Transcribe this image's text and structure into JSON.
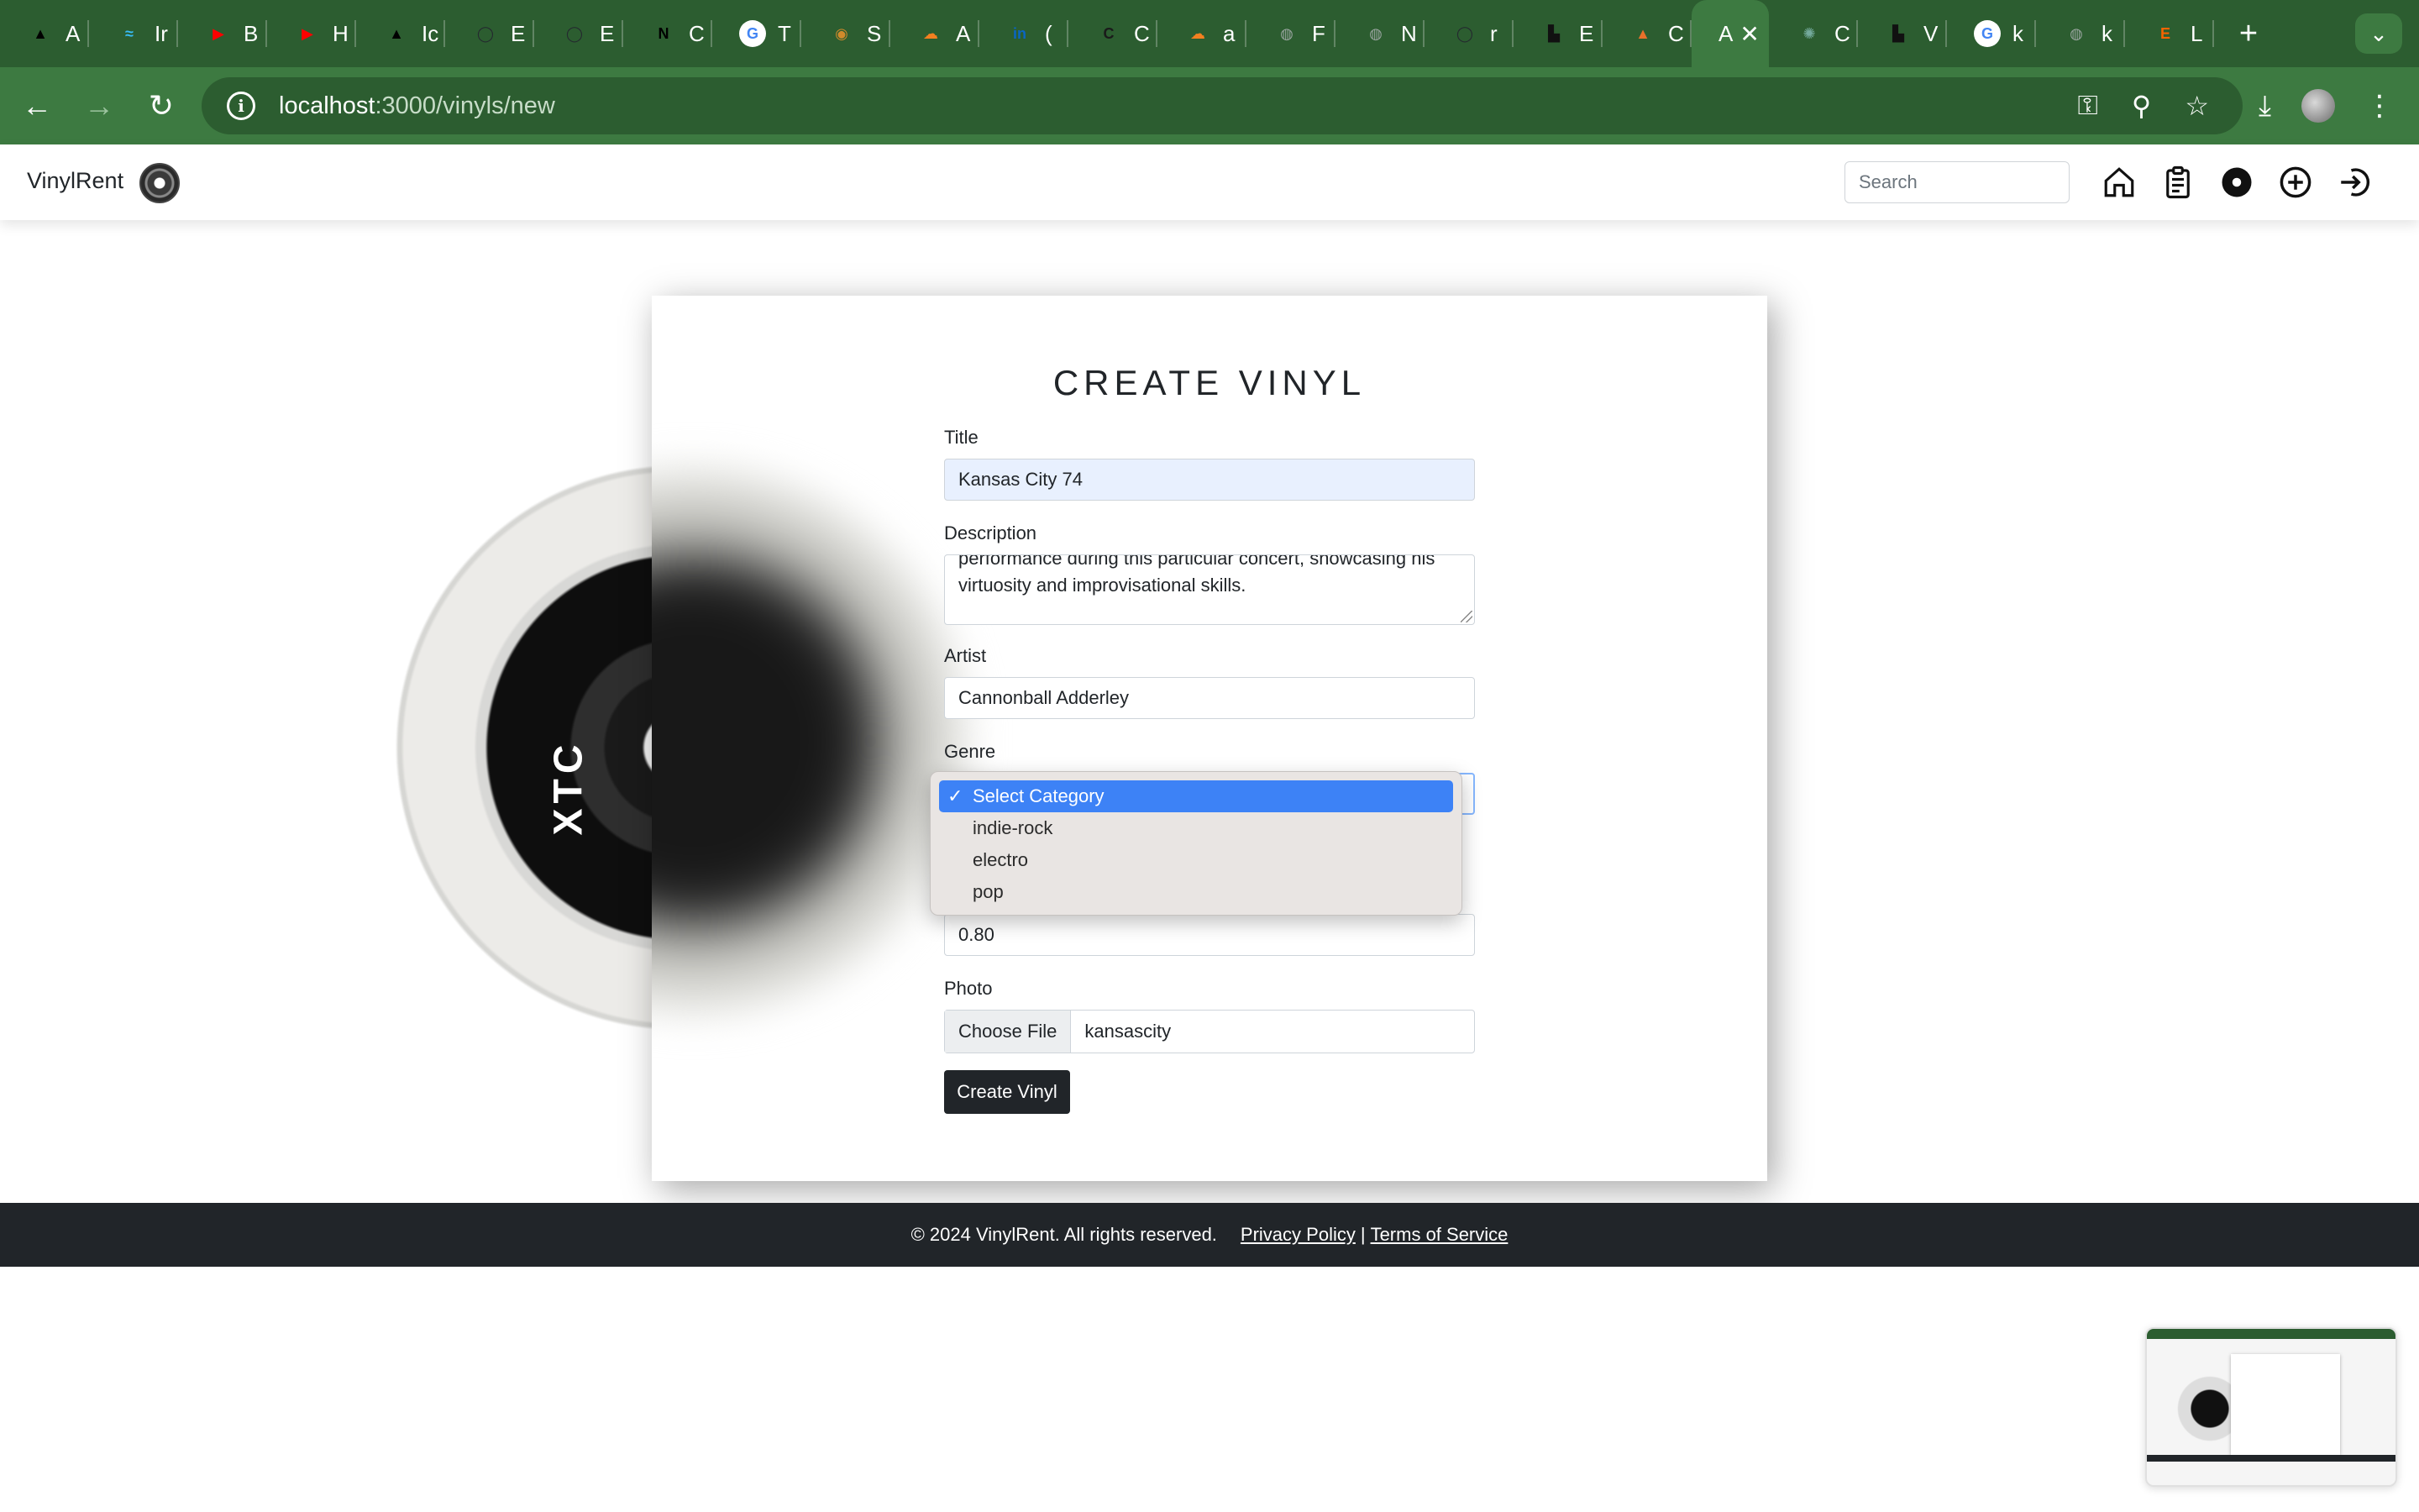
{
  "browser": {
    "tabs": [
      {
        "title": "A",
        "fav": "▲",
        "color": "#000000"
      },
      {
        "title": "Ir",
        "fav": "≈",
        "color": "#38bdf8"
      },
      {
        "title": "B",
        "fav": "▶",
        "color": "#ff0000"
      },
      {
        "title": "H",
        "fav": "▶",
        "color": "#ff0000"
      },
      {
        "title": "Ic",
        "fav": "▲",
        "color": "#000000"
      },
      {
        "title": "E",
        "fav": "◯",
        "color": "#24292f"
      },
      {
        "title": "E",
        "fav": "◯",
        "color": "#24292f"
      },
      {
        "title": "C",
        "fav": "N",
        "color": "#000000"
      },
      {
        "title": "T",
        "fav": "G",
        "color": "#ffffff"
      },
      {
        "title": "S",
        "fav": "◉",
        "color": "#d08a2b"
      },
      {
        "title": "A",
        "fav": "☁",
        "color": "#f38020"
      },
      {
        "title": "(",
        "fav": "in",
        "color": "#0a66c2"
      },
      {
        "title": "C",
        "fav": "C",
        "color": "#1a1a1a"
      },
      {
        "title": "a",
        "fav": "☁",
        "color": "#f38020"
      },
      {
        "title": "F",
        "fav": "◍",
        "color": "#9aa5a0"
      },
      {
        "title": "N",
        "fav": "◍",
        "color": "#9aa5a0"
      },
      {
        "title": "r",
        "fav": "◯",
        "color": "#24292f"
      },
      {
        "title": "E",
        "fav": "▙",
        "color": "#111111"
      },
      {
        "title": "C",
        "fav": "▲",
        "color": "#e8702a"
      }
    ],
    "active_tab": {
      "title": "A",
      "close": "✕"
    },
    "tabs_after": [
      {
        "title": "C",
        "fav": "✺",
        "color": "#74aa9c"
      },
      {
        "title": "V",
        "fav": "▙",
        "color": "#111111"
      },
      {
        "title": "k",
        "fav": "G",
        "color": "#ffffff"
      },
      {
        "title": "k",
        "fav": "◍",
        "color": "#9aa5a0"
      },
      {
        "title": "L",
        "fav": "E",
        "color": "#f56400"
      }
    ],
    "new_tab": "+",
    "tab_menu": "⌄",
    "nav": {
      "back": "←",
      "forward": "→",
      "reload": "↻"
    },
    "url_host": "localhost",
    "url_path": ":3000/vinyls/new",
    "omni_icons": {
      "key": "⚿",
      "zoom": "⚲",
      "star": "☆"
    },
    "toolbar_icons": {
      "download": "⤓",
      "menu": "⋮"
    }
  },
  "app": {
    "brand": "VinylRent",
    "search": {
      "placeholder": "Search"
    },
    "nav_icons": [
      "home-icon",
      "clipboard-icon",
      "vinyl-icon",
      "add-icon",
      "login-icon"
    ]
  },
  "background_vinyl_label": "XTC",
  "form": {
    "title": "CREATE VINYL",
    "title_label": "Title",
    "title_value": "Kansas City 74",
    "description_label": "Description",
    "description_value": "performance during this particular concert, showcasing his virtuosity and improvisational skills.",
    "artist_label": "Artist",
    "artist_value": "Cannonball Adderley",
    "genre_label": "Genre",
    "genre_selected": "Select Category",
    "genre_options": [
      "Select Category",
      "indie-rock",
      "electro",
      "pop"
    ],
    "price_value": "0.80",
    "photo_label": "Photo",
    "photo_button": "Choose File",
    "photo_filename": "kansascity",
    "submit": "Create Vinyl"
  },
  "footer": {
    "copyright": "© 2024 VinylRent. All rights reserved.",
    "privacy": "Privacy Policy",
    "separator": "|",
    "terms": "Terms of Service"
  },
  "colors": {
    "chrome_dark": "#2c5d30",
    "chrome": "#3d7a41",
    "footer": "#212529",
    "select_highlight": "#3d82f6"
  }
}
